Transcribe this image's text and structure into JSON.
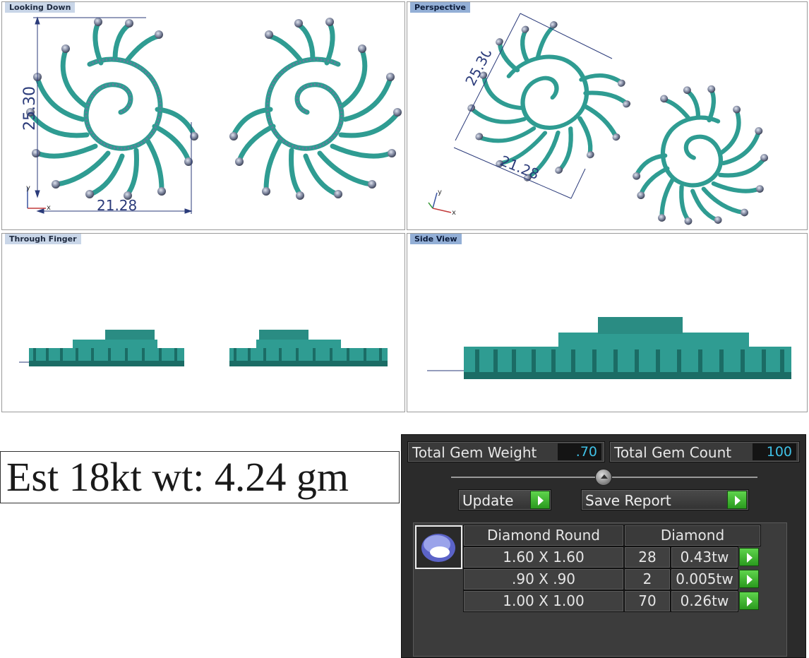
{
  "viewports": {
    "top_left": {
      "label": "Looking Down",
      "dim_vertical": "25.30",
      "dim_horizontal": "21.28",
      "axis_y": "y",
      "axis_x": "x"
    },
    "top_right": {
      "label": "Perspective",
      "dim_diag_a": "25.30",
      "dim_diag_b": "21.28",
      "axis_y": "y",
      "axis_x": "x"
    },
    "bottom_left": {
      "label": "Through Finger"
    },
    "bottom_right": {
      "label": "Side View"
    }
  },
  "estimate": {
    "text": "Est 18kt wt: 4.24 gm"
  },
  "panel": {
    "total_gem_weight_label": "Total Gem Weight",
    "total_gem_weight_value": ".70",
    "total_gem_count_label": "Total Gem Count",
    "total_gem_count_value": "100",
    "update_label": "Update",
    "save_report_label": "Save Report",
    "table": {
      "headers": [
        "Diamond Round",
        "Diamond"
      ],
      "rows": [
        {
          "size": "1.60 X 1.60",
          "count": "28",
          "weight": "0.43tw"
        },
        {
          "size": ".90 X .90",
          "count": "2",
          "weight": "0.005tw"
        },
        {
          "size": "1.00 X 1.00",
          "count": "70",
          "weight": "0.26tw"
        }
      ]
    }
  },
  "colors": {
    "metal": "#2f9c92",
    "metal_dark": "#1b6c65",
    "gem": "#8a92a8",
    "dimension": "#2b3b7a",
    "value_text": "#3fc1e6",
    "green_button": "#3cb52c"
  }
}
